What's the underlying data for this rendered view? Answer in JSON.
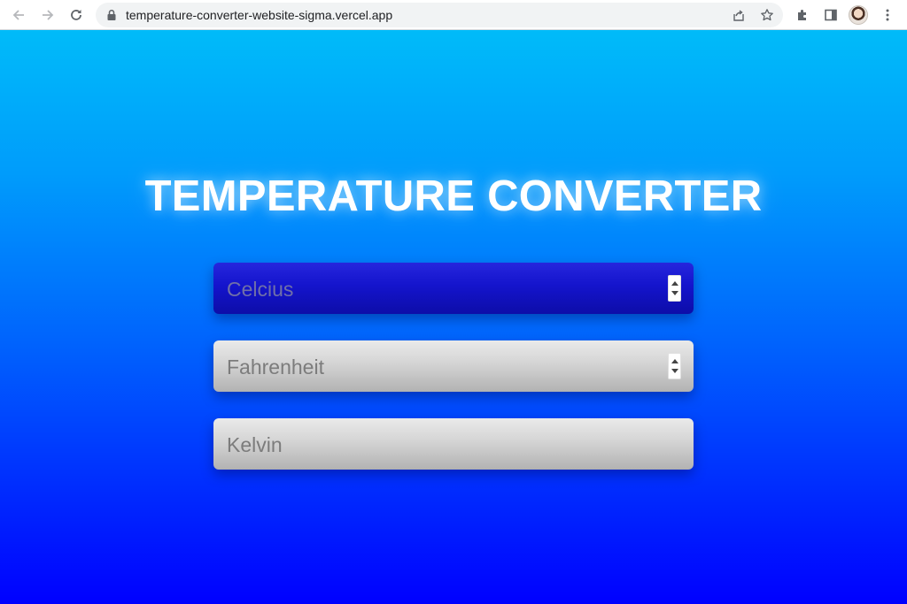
{
  "browser": {
    "url": "temperature-converter-website-sigma.vercel.app",
    "icons": {
      "back": "back-arrow-icon",
      "forward": "forward-arrow-icon",
      "reload": "reload-icon",
      "lock": "lock-icon",
      "share": "share-icon",
      "bookmark": "star-icon",
      "extensions": "puzzle-icon",
      "side_panel": "side-panel-icon",
      "profile": "avatar",
      "menu": "kebab-menu-icon"
    }
  },
  "page": {
    "title": "TEMPERATURE CONVERTER",
    "background_top": "#00bbf9",
    "background_bottom": "#0000ff",
    "fields": {
      "celcius": {
        "placeholder": "Celcius",
        "value": ""
      },
      "fahrenheit": {
        "placeholder": "Fahrenheit",
        "value": ""
      },
      "kelvin": {
        "placeholder": "Kelvin",
        "value": ""
      }
    }
  }
}
